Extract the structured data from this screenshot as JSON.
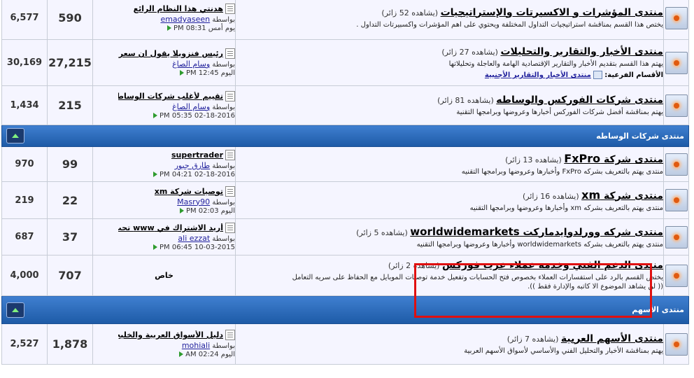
{
  "colors": {
    "category_bar": "#2a6cc0",
    "row_bg": "#f5f5ff",
    "highlight": "#e01010",
    "link": "#22229c"
  },
  "rows_top": [
    {
      "posts": "6,577",
      "threads": "590",
      "last_post": {
        "title": "هدنتي هذا النظام الرائع",
        "by_label": "بواسطة",
        "user": "emadyaseen",
        "time": "يوم أمس PM 08:31"
      },
      "forum": {
        "title": "منتدى المؤشرات و الاكسبرتات والإستراتيجيات",
        "viewing": "(يشاهده 52 زائر)",
        "description": "يختص هذا القسم بمناقشة استراتيجيات التداول المختلفة ويحتوي على اهم المؤشرات واكسبيرتات التداول ."
      }
    },
    {
      "posts": "30,169",
      "threads": "27,215",
      "last_post": {
        "title": "رئيس فنزويلا يقول ان سعر...",
        "by_label": "بواسطة",
        "user": "وسام الصاغ",
        "time": "اليوم PM 12:45"
      },
      "forum": {
        "title": "منتدى الأخبار والتقارير والتحليلات",
        "viewing": "(يشاهده 27 زائر)",
        "description": "يهتم هذا القسم بتقديم الأخبار والتقارير الإقتصادية الهامة والعاجلة وتحليلاتها",
        "subforums_label": "الأقسام الفرعية:",
        "subforum": "منتدى الأخبار والتقارير الأجنبية"
      }
    },
    {
      "posts": "1,434",
      "threads": "215",
      "last_post": {
        "title": "تقييم لأغلب شركات الوساطة",
        "by_label": "بواسطة",
        "user": "وسام الصاغ",
        "time": "02-18-2016 PM 05:35"
      },
      "forum": {
        "title": "منتدى شركات الفوركس والوساطه",
        "viewing": "(يشاهده 81 زائر)",
        "description": "يهتم بمناقشة أفضل شركات الفوركس أخبارها وعروضها وبرامجها التقنية"
      }
    }
  ],
  "category_brokers": {
    "name": "منتدى شركات الوساطه"
  },
  "rows_brokers": [
    {
      "posts": "970",
      "threads": "99",
      "last_post": {
        "title": "supertrader",
        "by_label": "بواسطة",
        "user": "طارق جبور",
        "time": "02-18-2016 PM 04:21"
      },
      "forum": {
        "title_prefix": "منتدى شركة",
        "title_brand": "FxPro",
        "viewing": "(يشاهده 13 زائر)",
        "description": "منتدى يهتم بالتعريف بشركه FxPro وأخبارها وعروضها وبرامجها التقنيه"
      }
    },
    {
      "posts": "219",
      "threads": "22",
      "last_post": {
        "title": "توصيات شركة xm",
        "by_label": "بواسطة",
        "user": "Masry90",
        "time": "اليوم PM 02:03"
      },
      "forum": {
        "title_prefix": "منتدى شركة",
        "title_brand": "xm",
        "viewing": "(يشاهده 16 زائر)",
        "description": "منتدى يهتم بالتعريف بشركه xm وأخبارها وعروضها وبرامجها التقنيه"
      }
    },
    {
      "posts": "687",
      "threads": "37",
      "last_post": {
        "title": "أريد الاشتراك في www تحت...",
        "by_label": "بواسطة",
        "user": "ali ezzat",
        "time": "10-03-2015 PM 06:45"
      },
      "forum": {
        "title_prefix": "منتدى شركه وورلدوايدماركت",
        "title_brand": "worldwidemarkets",
        "viewing": "(يشاهده 5 زائر)",
        "description": "منتدى يهتم بالتعريف بشركه worldwidemarkets وأخبارها وعروضها وبرامجها التقنيه"
      }
    },
    {
      "posts": "4,000",
      "threads": "707",
      "private_label": "خاص",
      "forum": {
        "title": "منتدى الدعم الفني وخدمة عملاء عرب فوركس",
        "viewing": "(يشاهده 2 زائر)",
        "description": "يختص القسم بالرد على استفسارات العملاء بخصوص فتح الحسابات وتفعيل خدمة توصيات الموبايل مع الحفاظ على سريه التعامل",
        "note": "(( لن يشاهد الموضوع الا كاتبه والإدارة فقط ))."
      }
    }
  ],
  "category_stocks": {
    "name": "منتدى الأسهم"
  },
  "rows_stocks": [
    {
      "posts": "2,527",
      "threads": "1,878",
      "last_post": {
        "title": "دليل الأسواق العربية والخليجية",
        "by_label": "بواسطة",
        "user": "mohiali",
        "time": "اليوم AM 02:24"
      },
      "forum": {
        "title": "منتدى الأسهم العربية",
        "viewing": "(يشاهده 7 زائر)",
        "description": "يهتم بمناقشة الأخبار والتحليل الفني والأساسي لأسواق الأسهم العربية"
      }
    }
  ]
}
